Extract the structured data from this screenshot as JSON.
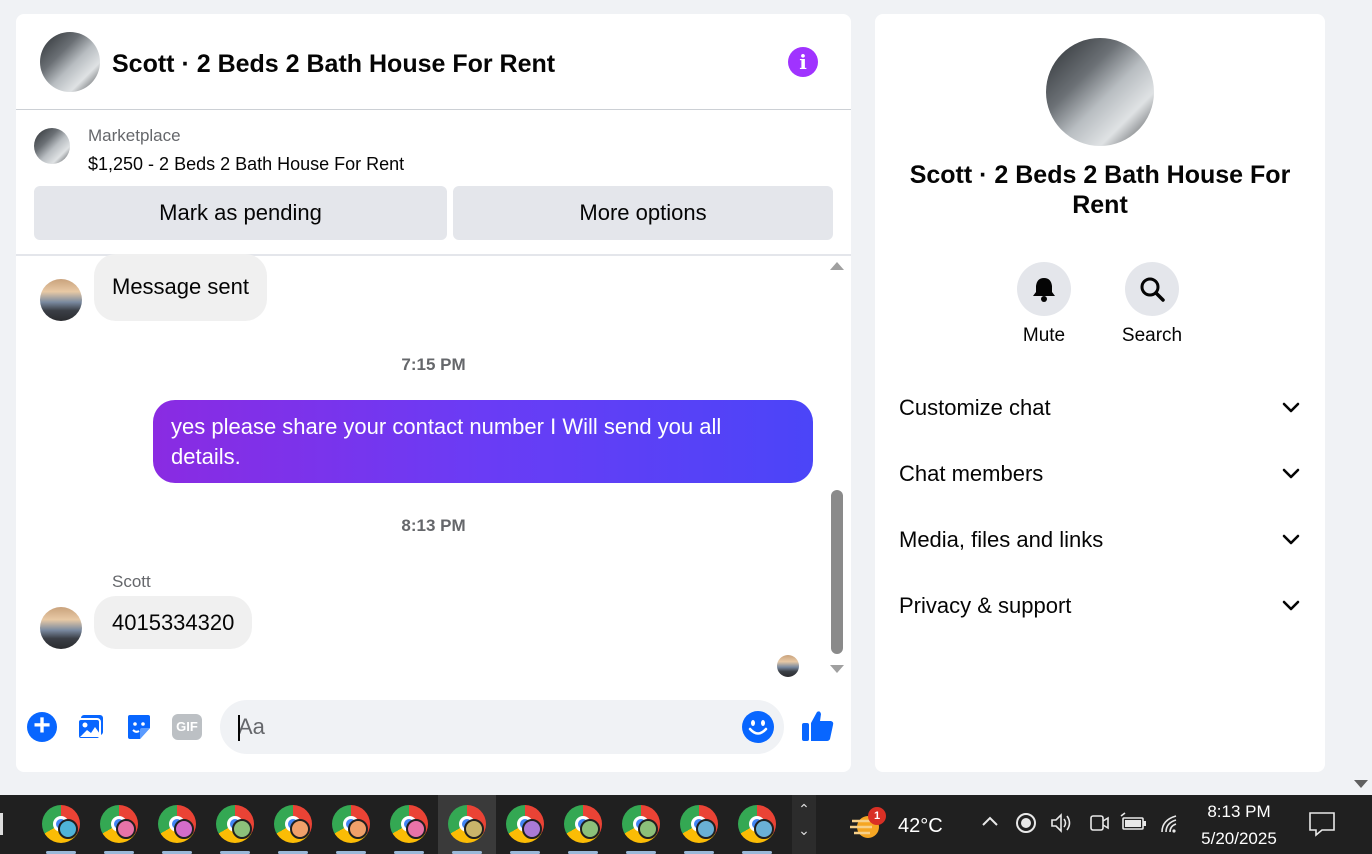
{
  "chat": {
    "title": "Scott · 2 Beds 2 Bath House For Rent",
    "marketplace_label": "Marketplace",
    "listing": "$1,250 - 2 Beds 2 Bath House For Rent",
    "mark_pending_label": "Mark as pending",
    "more_options_label": "More options",
    "messages": [
      {
        "text": "Message sent",
        "direction": "in"
      },
      {
        "timestamp": "7:15 PM"
      },
      {
        "text": "yes please share your contact number I Will send you all details.",
        "direction": "out"
      },
      {
        "timestamp": "8:13 PM"
      },
      {
        "sender": "Scott",
        "text": "4015334320",
        "direction": "in"
      }
    ],
    "composer": {
      "placeholder": "Aa",
      "gif_label": "GIF"
    },
    "colors": {
      "accent": "#0866ff",
      "info": "#a033ff",
      "outgoing_start": "#8a2be2",
      "outgoing_end": "#4b45f8"
    }
  },
  "sidebar": {
    "title": "Scott · 2 Beds 2 Bath House For Rent",
    "actions": [
      {
        "label": "Mute",
        "icon": "bell-icon"
      },
      {
        "label": "Search",
        "icon": "search-icon"
      }
    ],
    "sections": [
      {
        "label": "Customize chat"
      },
      {
        "label": "Chat members"
      },
      {
        "label": "Media, files and links"
      },
      {
        "label": "Privacy & support"
      }
    ]
  },
  "taskbar": {
    "apps": [
      {
        "icon": "chrome-icon",
        "badge_color": "#4fb3d9"
      },
      {
        "icon": "chrome-icon",
        "badge_color": "#e873a8"
      },
      {
        "icon": "chrome-icon",
        "badge_color": "#d36cc9"
      },
      {
        "icon": "chrome-icon",
        "badge_color": "#8cc07a"
      },
      {
        "icon": "chrome-icon",
        "badge_color": "#f0a06a"
      },
      {
        "icon": "chrome-icon",
        "badge_color": "#f0a06a"
      },
      {
        "icon": "chrome-icon",
        "badge_color": "#e873a8"
      },
      {
        "icon": "chrome-icon",
        "badge_color": "#c9b46a",
        "active": true
      },
      {
        "icon": "chrome-icon",
        "badge_color": "#a97ad6"
      },
      {
        "icon": "chrome-icon",
        "badge_color": "#8cc07a"
      },
      {
        "icon": "chrome-icon",
        "badge_color": "#8cc07a"
      },
      {
        "icon": "chrome-icon",
        "badge_color": "#6ab0d6"
      },
      {
        "icon": "chrome-icon",
        "badge_color": "#6ab0d6"
      }
    ],
    "weather_badge": "1",
    "temperature": "42°C",
    "time": "8:13 PM",
    "date": "5/20/2025"
  }
}
